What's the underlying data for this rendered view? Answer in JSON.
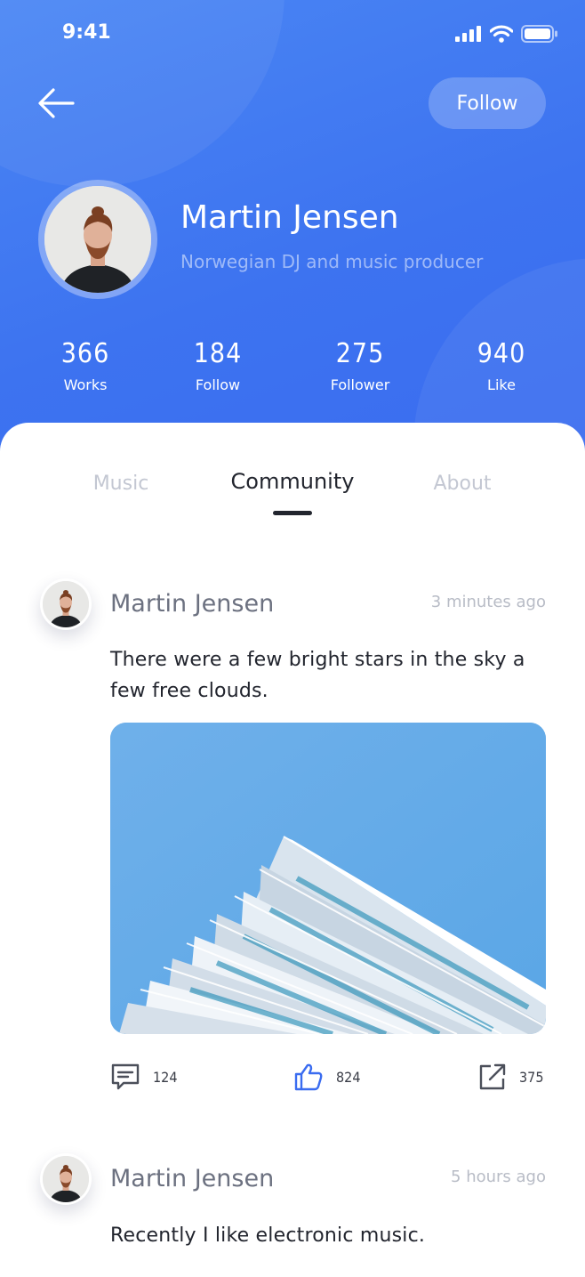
{
  "status_bar": {
    "time": "9:41"
  },
  "header": {
    "follow_label": "Follow",
    "name": "Martin Jensen",
    "subtitle": "Norwegian DJ and music producer"
  },
  "stats": [
    {
      "value": "366",
      "label": "Works"
    },
    {
      "value": "184",
      "label": "Follow"
    },
    {
      "value": "275",
      "label": "Follower"
    },
    {
      "value": "940",
      "label": "Like"
    }
  ],
  "tabs": [
    {
      "label": "Music",
      "active": false
    },
    {
      "label": "Community",
      "active": true
    },
    {
      "label": "About",
      "active": false
    }
  ],
  "posts": [
    {
      "author": "Martin Jensen",
      "time": "3 minutes ago",
      "text": "There were a few bright stars in the sky a few free clouds.",
      "comments": "124",
      "likes": "824",
      "shares": "375"
    },
    {
      "author": "Martin Jensen",
      "time": "5 hours ago",
      "text": "Recently I like electronic music."
    }
  ],
  "colors": {
    "header_blue": "#3d73f0",
    "like_icon": "#3a6cf0"
  },
  "icons": [
    "signal-icon",
    "wifi-icon",
    "battery-icon",
    "back-arrow-icon",
    "comment-icon",
    "thumbs-up-icon",
    "share-icon"
  ]
}
